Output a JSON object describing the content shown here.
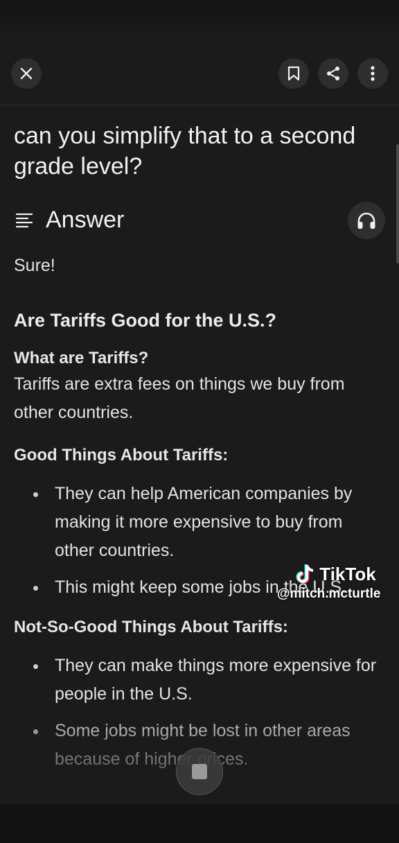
{
  "header": {
    "close_icon": "close-icon",
    "bookmark_icon": "bookmark-icon",
    "share_icon": "share-icon",
    "more_icon": "more-vertical-icon"
  },
  "question": "can you simplify that to a second grade level?",
  "answer": {
    "title": "Answer",
    "title_icon": "answer-lines-icon",
    "listen_icon": "headphones-icon",
    "intro": "Sure!",
    "heading": "Are Tariffs Good for the U.S.?",
    "sections": [
      {
        "title": "What are Tariffs?",
        "text": "Tariffs are extra fees on things we buy from other countries."
      },
      {
        "title": "Good Things About Tariffs:",
        "bullets": [
          "They can help American companies by making it more expensive to buy from other countries.",
          "This might keep some jobs in the U.S."
        ]
      },
      {
        "title": "Not-So-Good Things About Tariffs:",
        "bullets": [
          "They can make things more expensive for people in the U.S.",
          "Some jobs might be lost in other areas because of higher prices."
        ]
      }
    ]
  },
  "stop_icon": "stop-icon",
  "watermark": {
    "brand": "TikTok",
    "handle": "@mitch.mcturtle"
  },
  "colors": {
    "background": "#1b1b1b",
    "button_bg": "#2e2e2e",
    "text": "#e3e3e3"
  }
}
